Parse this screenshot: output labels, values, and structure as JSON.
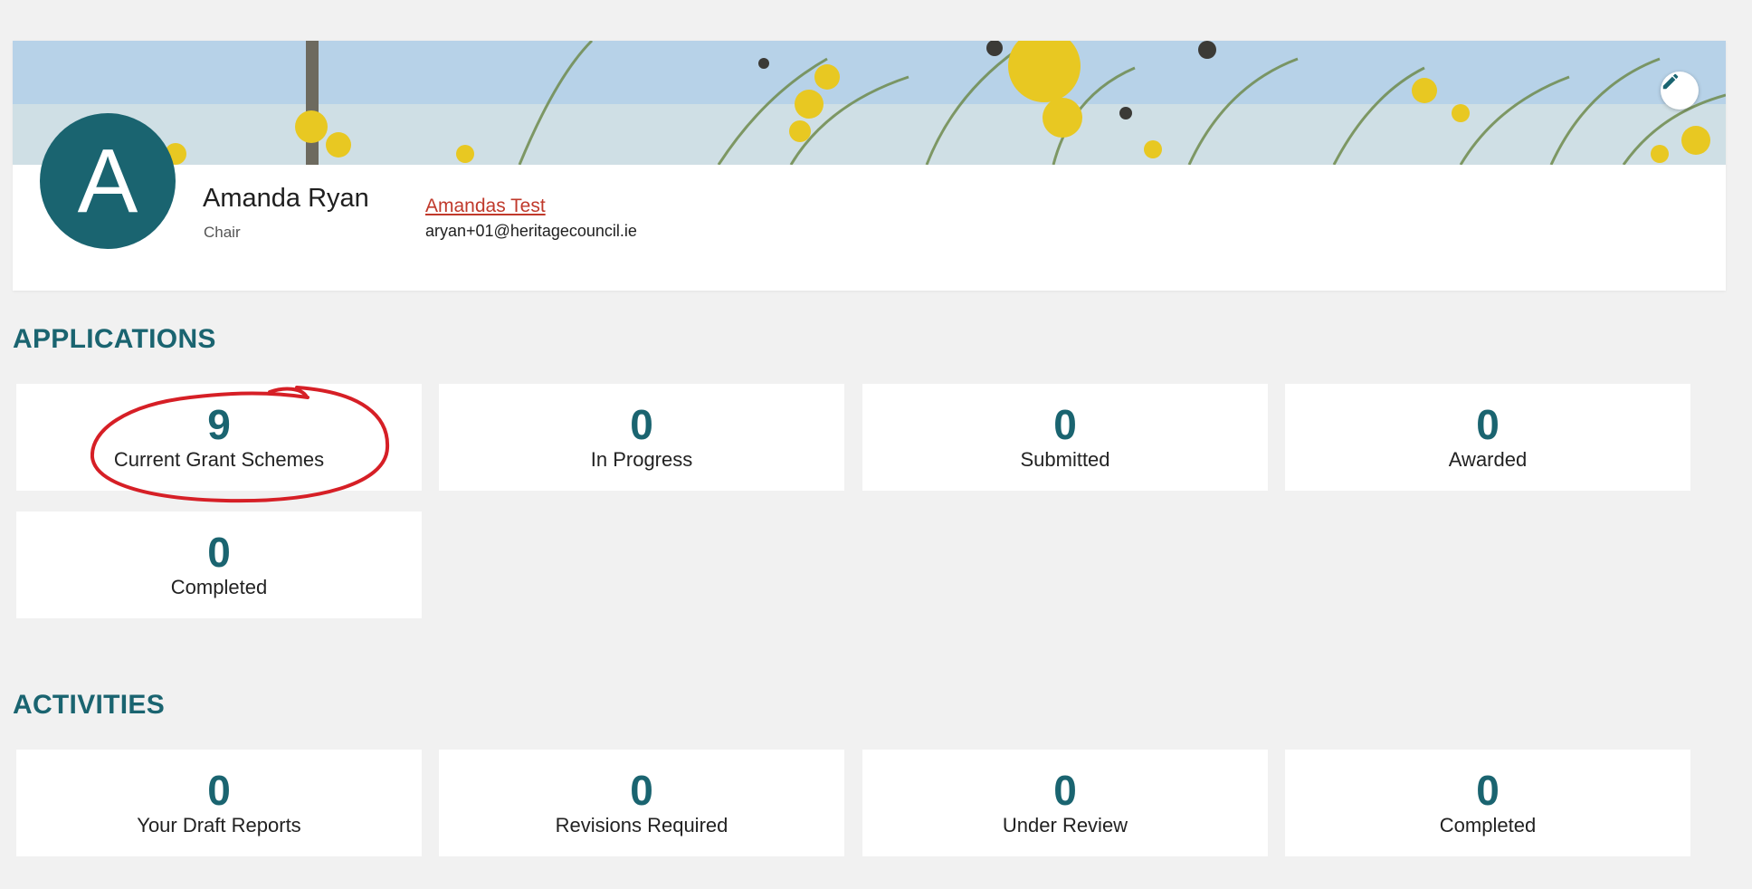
{
  "profile": {
    "avatar_initial": "A",
    "name": "Amanda Ryan",
    "role": "Chair",
    "organisation": "Amandas Test",
    "email": "aryan+01@heritagecouncil.ie"
  },
  "icons": {
    "edit": "pencil-icon"
  },
  "applications": {
    "title": "APPLICATIONS",
    "tiles": [
      {
        "count": "9",
        "label": "Current Grant Schemes"
      },
      {
        "count": "0",
        "label": "In Progress"
      },
      {
        "count": "0",
        "label": "Submitted"
      },
      {
        "count": "0",
        "label": "Awarded"
      },
      {
        "count": "0",
        "label": "Completed"
      }
    ]
  },
  "activities": {
    "title": "ACTIVITIES",
    "tiles": [
      {
        "count": "0",
        "label": "Your Draft Reports"
      },
      {
        "count": "0",
        "label": "Revisions Required"
      },
      {
        "count": "0",
        "label": "Under Review"
      },
      {
        "count": "0",
        "label": "Completed"
      }
    ]
  },
  "colors": {
    "accent": "#1a6470",
    "link": "#c0392b",
    "annotation": "#d61f26",
    "background": "#f1f1f1"
  }
}
